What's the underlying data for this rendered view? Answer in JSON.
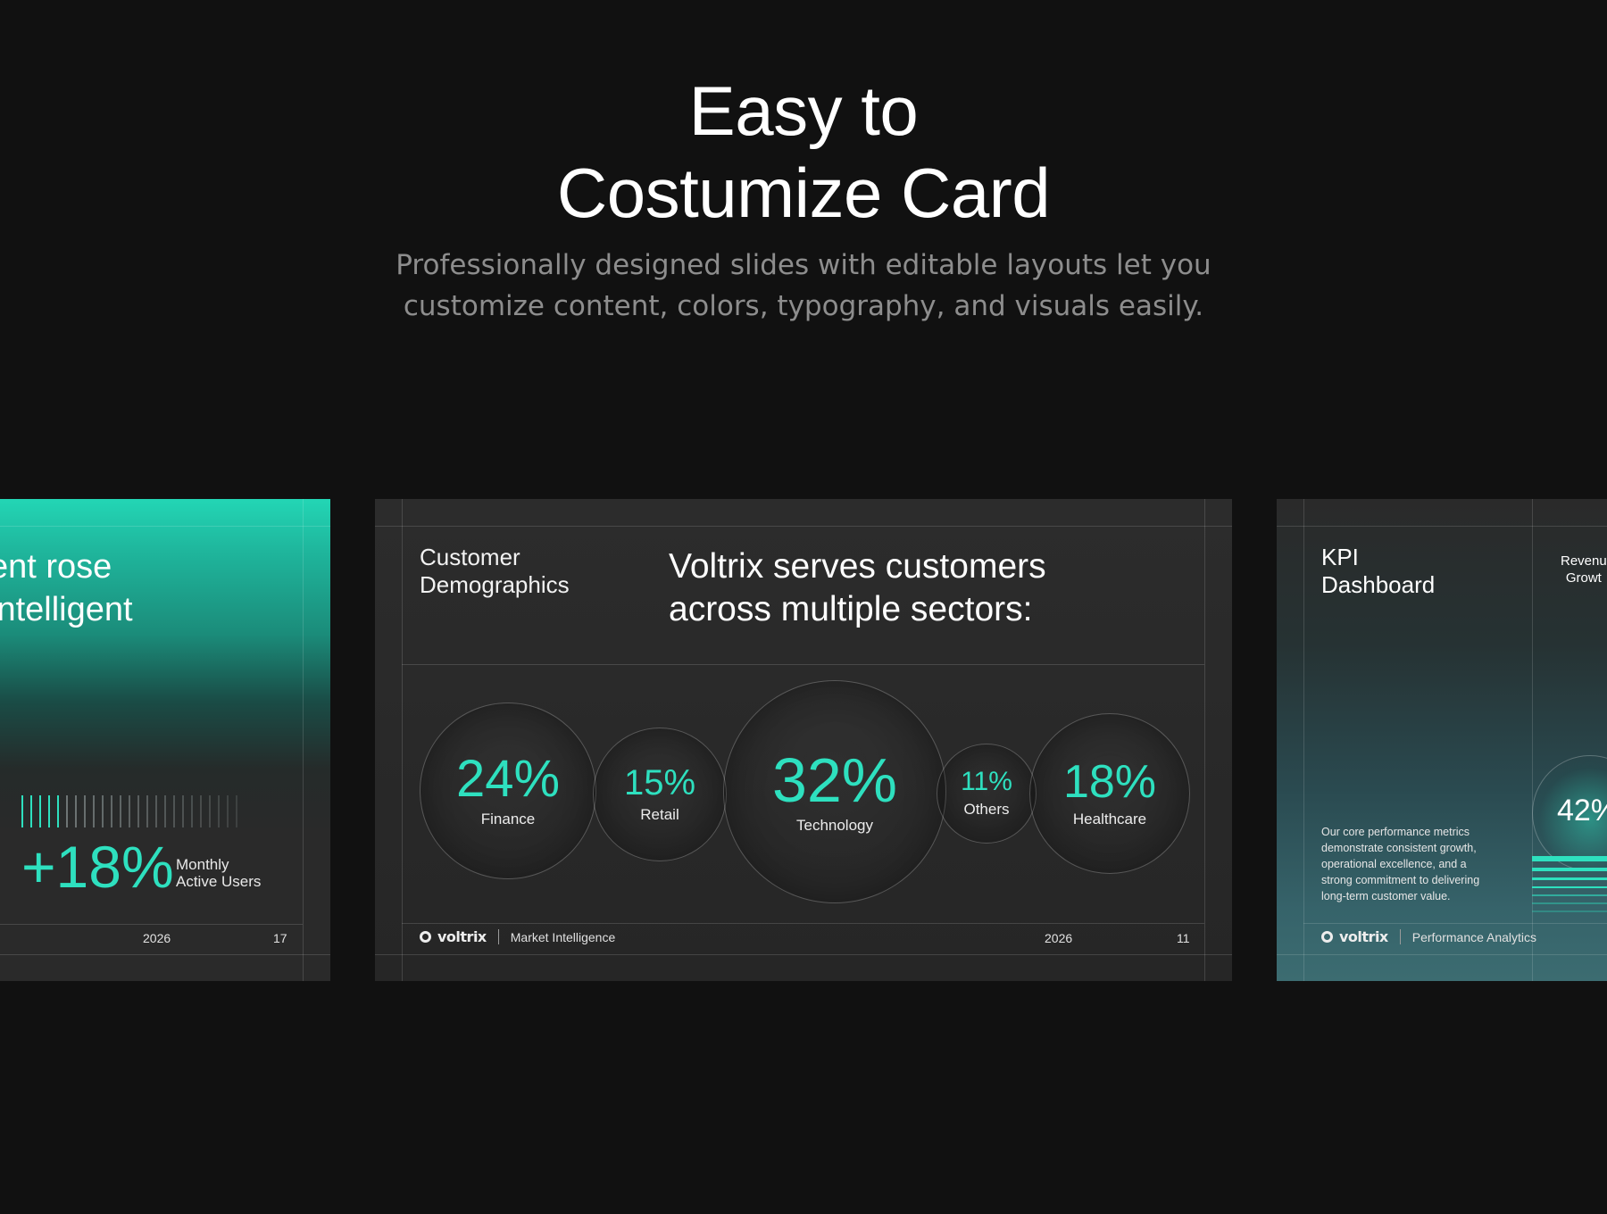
{
  "hero": {
    "title_line1": "Easy to",
    "title_line2": "Costumize Card",
    "subtitle_line1": "Professionally designed slides with editable layouts let you",
    "subtitle_line2": "customize content, colors, typography, and visuals easily."
  },
  "colors": {
    "background": "#111111",
    "accent": "#2ee0bf",
    "slide_bg": "#2a2a2a"
  },
  "slide_left": {
    "headline_line1": "ent rose",
    "headline_line2": "intelligent",
    "kpi_value": "+18%",
    "kpi_label_line1": "Monthly",
    "kpi_label_line2": "Active Users",
    "year": "2026",
    "page": "17"
  },
  "slide_center": {
    "section_line1": "Customer",
    "section_line2": "Demographics",
    "headline_line1": "Voltrix serves customers",
    "headline_line2": "across multiple sectors:",
    "sectors": [
      {
        "pct": "24%",
        "label": "Finance"
      },
      {
        "pct": "15%",
        "label": "Retail"
      },
      {
        "pct": "32%",
        "label": "Technology"
      },
      {
        "pct": "11%",
        "label": "Others"
      },
      {
        "pct": "18%",
        "label": "Healthcare"
      }
    ],
    "brand": "voltrix",
    "brand_sub": "Market Intelligence",
    "year": "2026",
    "page": "11"
  },
  "slide_right": {
    "title_line1": "KPI",
    "title_line2": "Dashboard",
    "col_label_line1": "Revenu",
    "col_label_line2": "Growt",
    "circle_value": "42%",
    "paragraph": "Our core performance metrics demonstrate consistent growth, operational excellence, and a strong commitment to delivering long-term customer value.",
    "brand": "voltrix",
    "brand_sub": "Performance Analytics"
  },
  "icons": {
    "brand_logo": "ring-logo-icon"
  }
}
